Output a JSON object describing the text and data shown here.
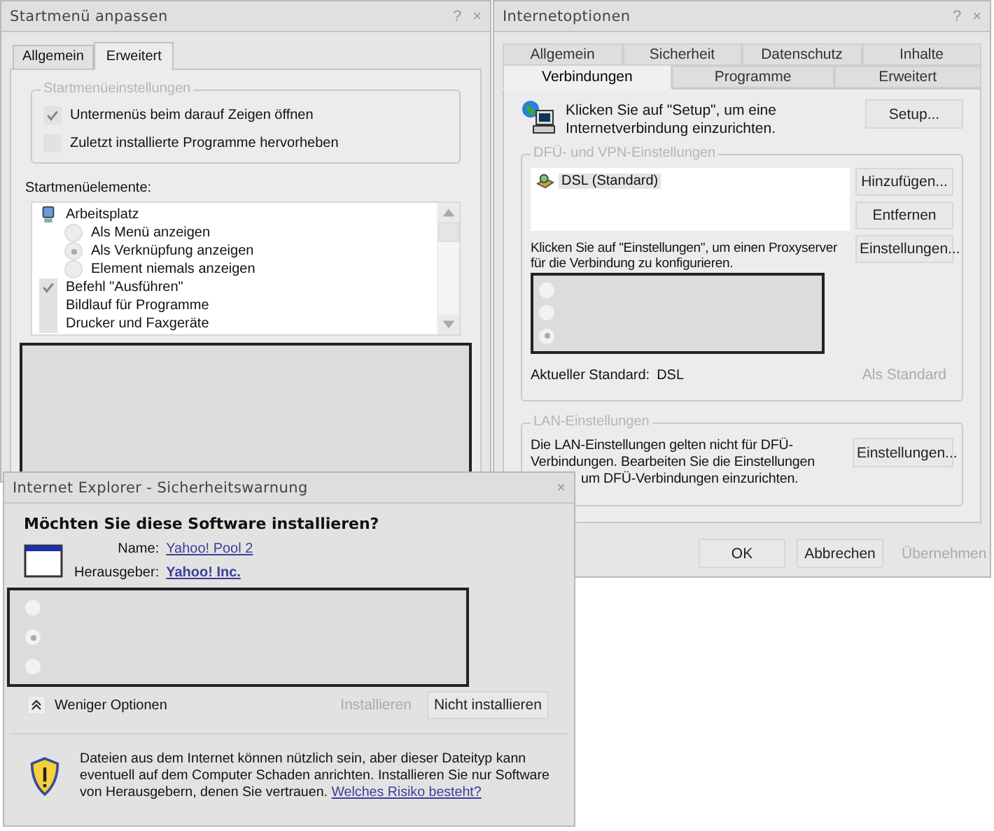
{
  "start_menu_dialog": {
    "title": "Startmenü anpassen",
    "help_glyph": "?",
    "close_glyph": "×",
    "tabs": [
      {
        "label": "Allgemein",
        "selected": false
      },
      {
        "label": "Erweitert",
        "selected": true
      }
    ],
    "settings_group": {
      "legend": "Startmenüeinstellungen",
      "options": [
        {
          "label": "Untermenüs beim darauf Zeigen öffnen",
          "checked": true
        },
        {
          "label": "Zuletzt installierte Programme hervorheben",
          "checked": false
        }
      ]
    },
    "elements_label": "Startmenüelemente:",
    "elements": [
      {
        "kind": "item",
        "label": "Arbeitsplatz"
      },
      {
        "kind": "radio",
        "label": "Als Menü anzeigen",
        "selected": false
      },
      {
        "kind": "radio",
        "label": "Als Verknüpfung anzeigen",
        "selected": true
      },
      {
        "kind": "radio",
        "label": "Element niemals anzeigen",
        "selected": false
      },
      {
        "kind": "checkbox",
        "label": "Befehl \"Ausführen\"",
        "checked": true
      },
      {
        "kind": "checkbox",
        "label": "Bildlauf für Programme",
        "checked": false
      },
      {
        "kind": "checkbox",
        "label": "Drucker und Faxgeräte",
        "checked": false
      }
    ]
  },
  "internet_options": {
    "title": "Internetoptionen",
    "help_glyph": "?",
    "close_glyph": "×",
    "tabs_back_row": [
      {
        "label": "Allgemein",
        "selected": false
      },
      {
        "label": "Sicherheit",
        "selected": false
      },
      {
        "label": "Datenschutz",
        "selected": false
      },
      {
        "label": "Inhalte",
        "selected": false
      }
    ],
    "tabs_front_row": [
      {
        "label": "Verbindungen",
        "selected": true
      },
      {
        "label": "Programme",
        "selected": false
      },
      {
        "label": "Erweitert",
        "selected": false
      }
    ],
    "setup_text": "Klicken Sie auf \"Setup\", um eine Internetverbindung einzurichten.",
    "setup_button": "Setup...",
    "dialup_group": {
      "legend": "DFÜ- und VPN-Einstellungen",
      "connections": [
        {
          "label": "DSL (Standard)",
          "selected": true
        }
      ],
      "add_button": "Hinzufügen...",
      "remove_button": "Entfernen",
      "settings_button": "Einstellungen...",
      "proxy_text": "Klicken Sie auf \"Einstellungen\", um einen Proxyserver für die Verbindung zu konfigurieren.",
      "radios": [
        {
          "selected": false
        },
        {
          "selected": false
        },
        {
          "selected": true
        }
      ],
      "current_default_label": "Aktueller Standard:",
      "current_default_value": "DSL",
      "set_default_button": {
        "label": "Als Standard",
        "disabled": true
      }
    },
    "lan_group": {
      "legend": "LAN-Einstellungen",
      "text_lines": [
        "Die LAN-Einstellungen gelten nicht für DFÜ-",
        "Verbindungen. Bearbeiten Sie die Einstellungen",
        "um DFÜ-Verbindungen einzurichten."
      ],
      "button": "Einstellungen..."
    },
    "footer_buttons": [
      {
        "label": "OK",
        "disabled": false
      },
      {
        "label": "Abbrechen",
        "disabled": false
      },
      {
        "label": "Übernehmen",
        "disabled": true
      }
    ]
  },
  "security_warning": {
    "title": "Internet Explorer - Sicherheitswarnung",
    "close_glyph": "×",
    "question": "Möchten Sie diese Software installieren?",
    "name_label": "Name:",
    "name_value": "Yahoo! Pool 2",
    "publisher_label": "Herausgeber:",
    "publisher_value": "Yahoo! Inc.",
    "radios": [
      {
        "selected": false
      },
      {
        "selected": true
      },
      {
        "selected": false
      }
    ],
    "options_toggle": "Weniger Optionen",
    "buttons": [
      {
        "label": "Installieren",
        "disabled": true
      },
      {
        "label": "Nicht installieren",
        "disabled": false
      }
    ],
    "warning_text": "Dateien aus dem Internet können nützlich sein, aber dieser Dateityp kann eventuell auf dem Computer Schaden anrichten. Installieren Sie nur Software von Herausgebern, denen Sie vertrauen.",
    "risk_link": "Welches Risiko besteht?"
  }
}
